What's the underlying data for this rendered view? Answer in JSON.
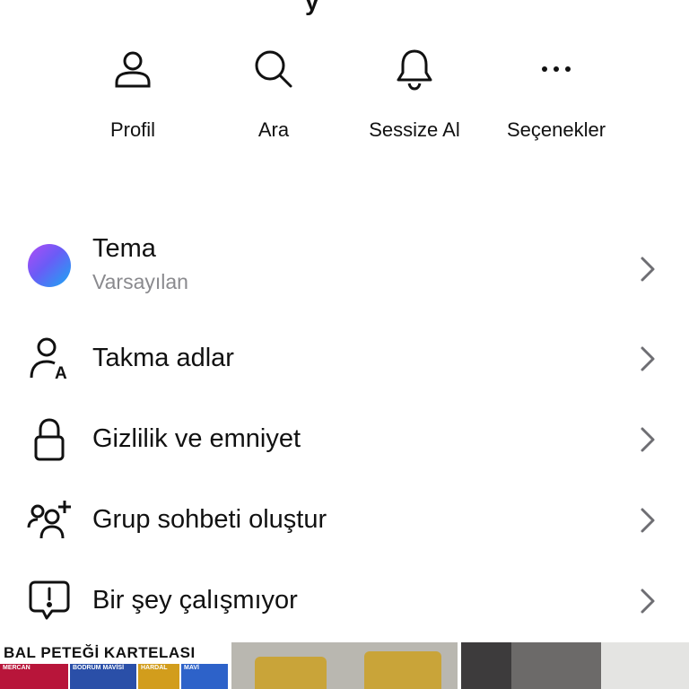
{
  "header": {
    "title_fragment": "y"
  },
  "actions": [
    {
      "label": "Profil",
      "icon": "profile-icon"
    },
    {
      "label": "Ara",
      "icon": "search-icon"
    },
    {
      "label": "Sessize Al",
      "icon": "bell-icon"
    },
    {
      "label": "Seçenekler",
      "icon": "more-icon"
    }
  ],
  "menu": {
    "theme": {
      "label": "Tema",
      "value": "Varsayılan"
    },
    "nicknames": {
      "label": "Takma adlar"
    },
    "privacy": {
      "label": "Gizlilik ve emniyet"
    },
    "group": {
      "label": "Grup sohbeti oluştur"
    },
    "report": {
      "label": "Bir şey çalışmıyor"
    }
  },
  "ads": {
    "ad1": {
      "title": "BAL PETEĞİ KARTELASI",
      "swatches": [
        {
          "name": "MERCAN",
          "color": "#b8153a"
        },
        {
          "name": "BODRUM MAVİSİ",
          "color": "#2a4fa8"
        },
        {
          "name": "HARDAL",
          "color": "#d29d1c"
        },
        {
          "name": "MAVİ",
          "color": "#2d62c9"
        }
      ]
    }
  },
  "colors": {
    "accent_gradient": [
      "#b04cf5",
      "#1aa8f3"
    ],
    "secondary_text": "#8a8a8e"
  }
}
